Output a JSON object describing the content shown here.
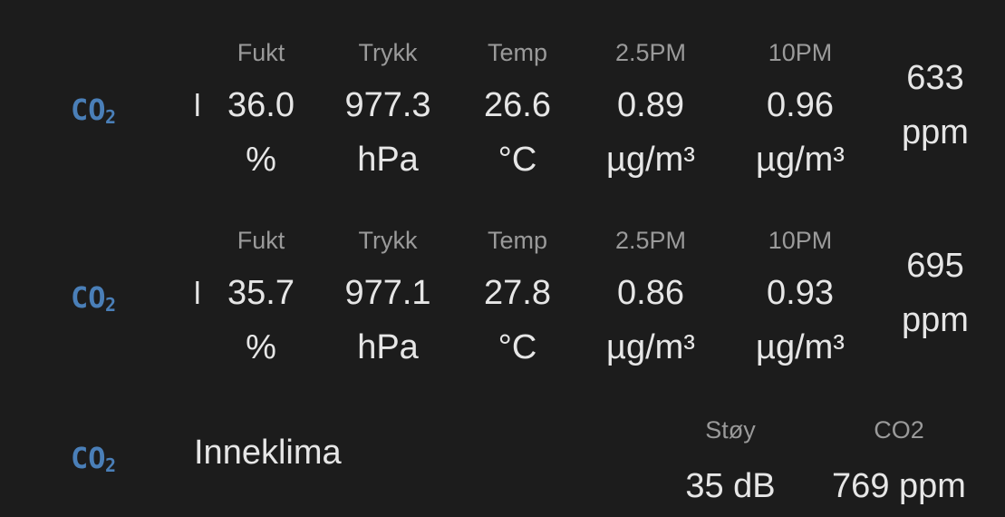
{
  "colors": {
    "background": "#1c1c1c",
    "icon": "#4a7fb8",
    "label": "#9a9a9a",
    "value": "#e6e6e6"
  },
  "icons": {
    "co2": "co2-icon",
    "marker": "l"
  },
  "rows": [
    {
      "fukt_label": "Fukt",
      "fukt_value": "36.0",
      "fukt_unit": "%",
      "trykk_label": "Trykk",
      "trykk_value": "977.3",
      "trykk_unit": "hPa",
      "temp_label": "Temp",
      "temp_value": "26.6",
      "temp_unit": "°C",
      "pm25_label": "2.5PM",
      "pm25_value": "0.89",
      "pm25_unit": "µg/m³",
      "pm10_label": "10PM",
      "pm10_value": "0.96",
      "pm10_unit": "µg/m³",
      "co2_value": "633",
      "co2_unit": "ppm"
    },
    {
      "fukt_label": "Fukt",
      "fukt_value": "35.7",
      "fukt_unit": "%",
      "trykk_label": "Trykk",
      "trykk_value": "977.1",
      "trykk_unit": "hPa",
      "temp_label": "Temp",
      "temp_value": "27.8",
      "temp_unit": "°C",
      "pm25_label": "2.5PM",
      "pm25_value": "0.86",
      "pm25_unit": "µg/m³",
      "pm10_label": "10PM",
      "pm10_value": "0.93",
      "pm10_unit": "µg/m³",
      "co2_value": "695",
      "co2_unit": "ppm"
    }
  ],
  "summary": {
    "title": "Inneklima",
    "noise_label": "Støy",
    "noise_value": "35 dB",
    "co2_label": "CO2",
    "co2_value": "769 ppm"
  }
}
